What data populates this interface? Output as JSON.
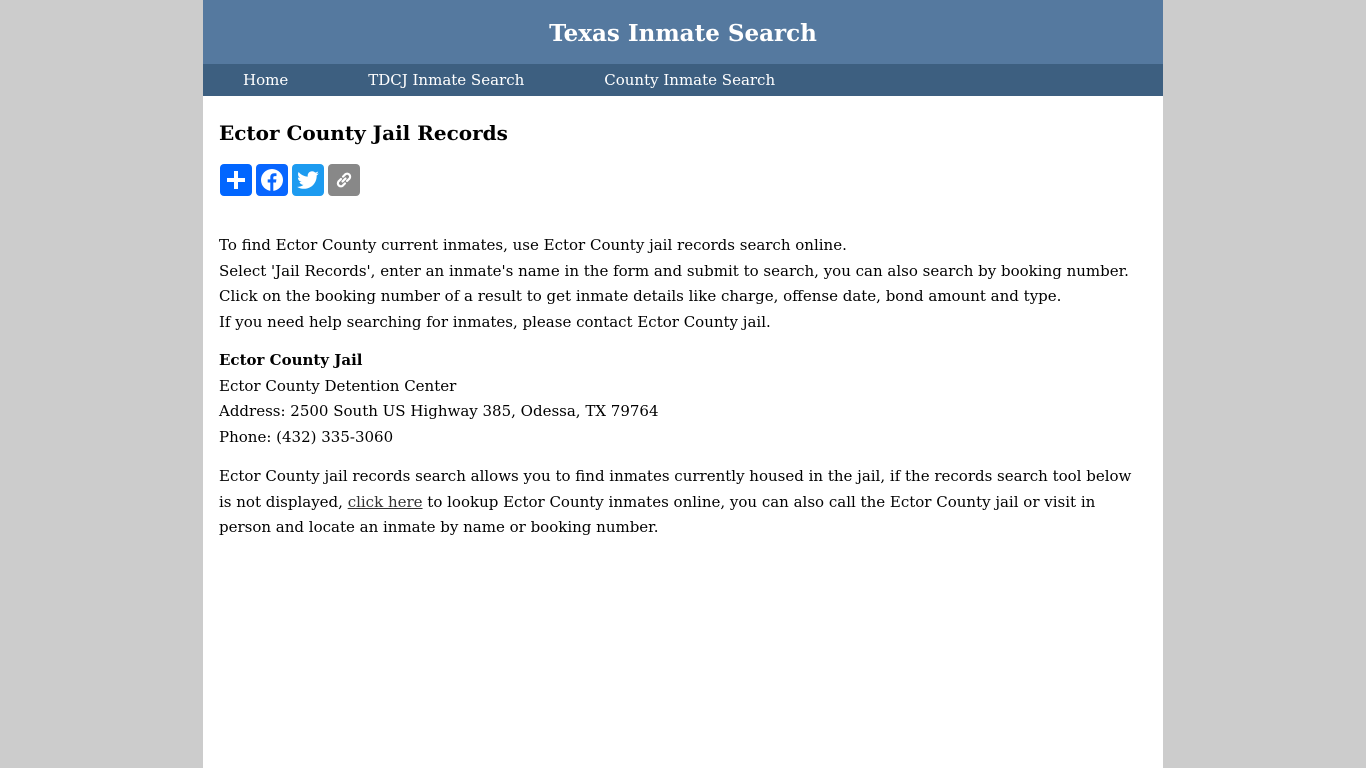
{
  "header": {
    "site_title": "Texas Inmate Search"
  },
  "nav": {
    "items": [
      {
        "label": "Home"
      },
      {
        "label": "TDCJ Inmate Search"
      },
      {
        "label": "County Inmate Search"
      }
    ]
  },
  "main": {
    "page_title": "Ector County Jail Records",
    "share_buttons": [
      {
        "label": "Share",
        "icon": "share-plus-icon",
        "color": "#0166ff"
      },
      {
        "label": "Facebook",
        "icon": "facebook-icon",
        "color": "#0866ff"
      },
      {
        "label": "Twitter",
        "icon": "twitter-icon",
        "color": "#1d9bf0"
      },
      {
        "label": "Copy Link",
        "icon": "link-icon",
        "color": "#888888"
      }
    ],
    "intro_lines": [
      "To find Ector County current inmates, use Ector County jail records search online.",
      "Select 'Jail Records', enter an inmate's name in the form and submit to search, you can also search by booking number.",
      "Click on the booking number of a result to get inmate details like charge, offense date, bond amount and type.",
      "If you need help searching for inmates, please contact Ector County jail."
    ],
    "jail_info": {
      "name": "Ector County Jail",
      "facility": "Ector County Detention Center",
      "address": "Address: 2500 South US Highway 385, Odessa, TX 79764",
      "phone": "Phone: (432) 335-3060"
    },
    "search_note": {
      "before_link": "Ector County jail records search allows you to find inmates currently housed in the jail, if the records search tool below is not displayed, ",
      "link_text": "click here",
      "after_link": " to lookup Ector County inmates online, you can also call the Ector County jail or visit in person and locate an inmate by name or booking number."
    }
  },
  "colors": {
    "header_bg": "#55799f",
    "nav_bg": "#3d5f80",
    "page_bg": "#cccccc"
  }
}
